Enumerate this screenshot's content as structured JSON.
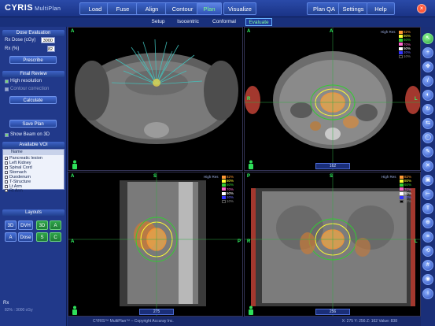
{
  "app": {
    "logo": "CYRIS",
    "logo_sub": "MultiPlan"
  },
  "tabs": [
    "Load",
    "Fuse",
    "Align",
    "Contour",
    "Plan",
    "Visualize",
    "Plan QA",
    "Settings",
    "Help"
  ],
  "active_tab": "Plan",
  "subtabs": [
    "Setup",
    "Isocentric",
    "Conformal",
    "Evaluate"
  ],
  "active_subtab": "Evaluate",
  "dose_eval": {
    "header": "Dose Evaluation",
    "rx_dose_label": "Rx Dose (cGy)",
    "rx_dose_value": "3000",
    "rx_pct_label": "Rx (%)",
    "rx_pct_value": "82",
    "prescribe": "Prescribe"
  },
  "final_review": {
    "header": "Final Review",
    "high_res": "High resolution",
    "contour_correction": "Contour correction",
    "calculate": "Calculate"
  },
  "save_plan": "Save Plan",
  "show_beam": "Show Beam on 3D",
  "voi": {
    "header": "Available VOI",
    "column": "Name",
    "items": [
      "Pancreatic lesion",
      "Left Kidney",
      "Spinal Cord",
      "Stomach",
      "Duodenum",
      "T-Structure",
      "Lt Arm",
      "Rt Arm"
    ]
  },
  "layouts": {
    "header": "Layouts",
    "buttons": [
      "3D",
      "DVH",
      "3D",
      "A",
      "A",
      "Dose",
      "S",
      "C"
    ]
  },
  "footer_left": {
    "rx_label": "Rx",
    "rx_text": "82% : 3000 cGy"
  },
  "viewer": {
    "orientation": [
      "A",
      "R",
      "L",
      "P",
      "S",
      "I"
    ],
    "legend_title": "High Res",
    "legend": [
      {
        "pct": "82%",
        "color": "#ff9933"
      },
      {
        "pct": "80%",
        "color": "#ffff33"
      },
      {
        "pct": "60%",
        "color": "#33cc33"
      },
      {
        "pct": "70%",
        "color": "#ff66cc"
      },
      {
        "pct": "50%",
        "color": "#ffffff"
      },
      {
        "pct": "20%",
        "color": "#3333ff"
      },
      {
        "pct": "10%",
        "color": "#000000"
      }
    ],
    "axial_slice": "162",
    "sag_slice": "275",
    "cor_slice": "256"
  },
  "status": {
    "left": "CYRIS™ MultiPlan™ – Copyright Accuray Inc.",
    "right": "X: 275  Y: 256  Z: 162  Value: 838"
  },
  "colors": {
    "accent": "#33ff66",
    "panel": "#21398a",
    "active_tab_text": "#7dff8a"
  }
}
